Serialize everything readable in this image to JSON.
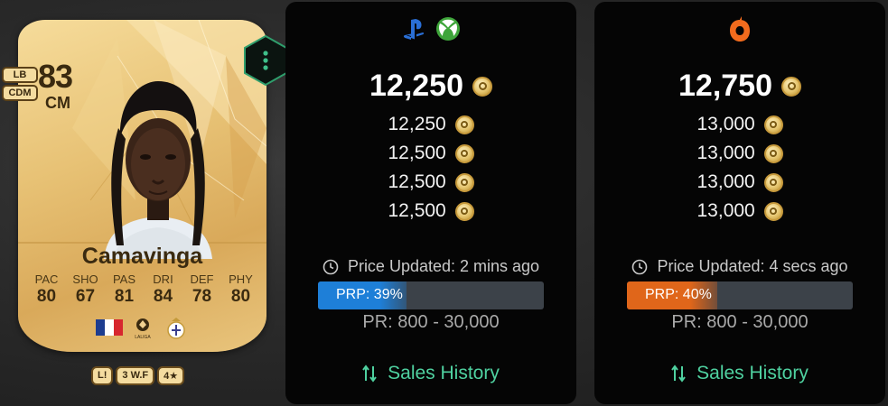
{
  "player": {
    "rating": "83",
    "position": "CM",
    "alt_positions": [
      "LB",
      "CDM"
    ],
    "name": "Camavinga",
    "stats": [
      {
        "label": "PAC",
        "value": "80"
      },
      {
        "label": "SHO",
        "value": "67"
      },
      {
        "label": "PAS",
        "value": "81"
      },
      {
        "label": "DRI",
        "value": "84"
      },
      {
        "label": "DEF",
        "value": "78"
      },
      {
        "label": "PHY",
        "value": "80"
      }
    ],
    "league_text": "LALIGA",
    "chips": [
      "L!",
      "3 W.F",
      "4★"
    ],
    "colors": {
      "card_gold": "#e7c174",
      "card_text": "#3a2a10"
    }
  },
  "menu_button": {
    "icon": "vertical-dots-icon",
    "color": "#3fbf8a"
  },
  "panels": [
    {
      "platform_icons": [
        "playstation-icon",
        "xbox-icon"
      ],
      "main_price": "12,250",
      "prices": [
        "12,250",
        "12,500",
        "12,500",
        "12,500"
      ],
      "updated": "Price Updated: 2 mins ago",
      "prp_label": "PRP: 39%",
      "prp_percent": 39,
      "prp_color": "#1e7fd8",
      "price_range": "PR: 800 - 30,000",
      "sales_label": "Sales History"
    },
    {
      "platform_icons": [
        "origin-icon"
      ],
      "main_price": "12,750",
      "prices": [
        "13,000",
        "13,000",
        "13,000",
        "13,000"
      ],
      "updated": "Price Updated: 4 secs ago",
      "prp_label": "PRP: 40%",
      "prp_percent": 40,
      "prp_color": "#e0661a",
      "price_range": "PR: 800 - 30,000",
      "sales_label": "Sales History"
    }
  ],
  "colors": {
    "accent_green": "#4fd1a0",
    "panel_bg": "#050505"
  }
}
